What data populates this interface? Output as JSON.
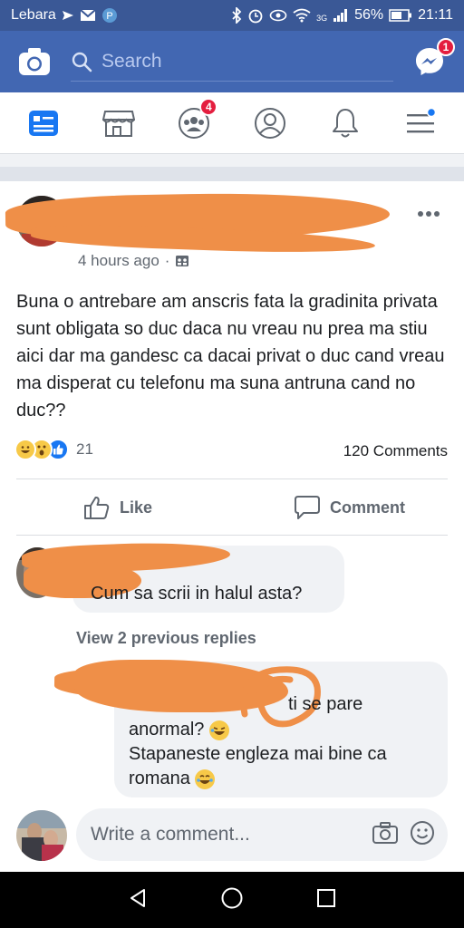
{
  "status_bar": {
    "carrier": "Lebara",
    "network": "3G",
    "battery": "56%",
    "time": "21:11"
  },
  "top_bar": {
    "search_placeholder": "Search",
    "messenger_badge": "1"
  },
  "nav_tabs": [
    {
      "name": "news-feed",
      "icon": "news-feed-icon",
      "active": true
    },
    {
      "name": "marketplace",
      "icon": "store-icon"
    },
    {
      "name": "groups",
      "icon": "groups-icon",
      "badge": "4"
    },
    {
      "name": "profile",
      "icon": "profile-icon"
    },
    {
      "name": "notifications",
      "icon": "bell-icon"
    },
    {
      "name": "menu",
      "icon": "menu-icon",
      "dot": true
    }
  ],
  "post": {
    "timestamp": "4 hours ago",
    "privacy_separator": "·",
    "text": "Buna o antrebare am anscris fata la gradinita privata sunt obligata so duc daca nu vreau nu prea ma stiu aici dar ma gandesc ca dacai privat o duc cand vreau ma  disperat cu telefonu ma suna antruna cand no duc??",
    "reaction_count": "21",
    "comments_count": "120 Comments",
    "like_label": "Like",
    "comment_label": "Comment"
  },
  "comments": [
    {
      "text": "Cum sa scrii in halul asta?"
    }
  ],
  "view_previous_replies": "View 2 previous replies",
  "reply": {
    "line1_fragment": "ti se pare",
    "line2": "anormal?",
    "line3": "Stapaneste engleza mai bine ca",
    "line4": "romana"
  },
  "composer": {
    "placeholder": "Write a comment..."
  },
  "colors": {
    "brand_blue": "#4267b2",
    "status_bar": "#3a5896",
    "badge_red": "#e41e3f",
    "redaction_orange": "#ef8f48"
  }
}
